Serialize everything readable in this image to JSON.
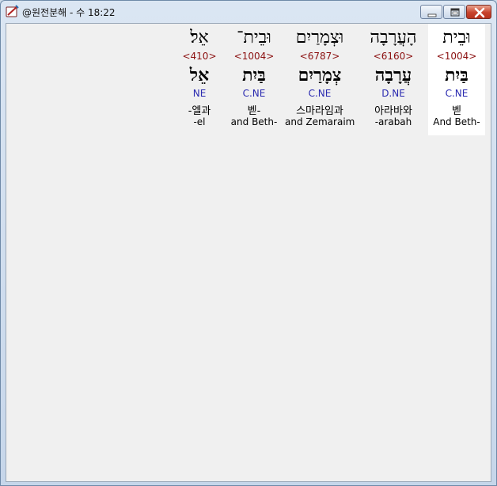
{
  "window": {
    "title": "@원전분해 - 수 18:22",
    "icon": "bible-pen-icon"
  },
  "controls": {
    "minimize": "minimize-icon",
    "maximize": "maximize-icon",
    "close": "close-icon"
  },
  "colors": {
    "strong_number": "#8b1010",
    "grammar": "#2a2ab0",
    "selected_bg": "#ffffff"
  },
  "words": [
    {
      "hebrew": "וּבֵית",
      "strong": "<1004>",
      "lemma": "בַּיִת",
      "grammar": "C.NE",
      "korean": "벧",
      "english": "And Beth-"
    },
    {
      "hebrew": "הָעֲרָבָה",
      "strong": "<6160>",
      "lemma": "עֲרָבָה",
      "grammar": "D.NE",
      "korean": "아라바와",
      "english": "-arabah"
    },
    {
      "hebrew": "וּצְמָרַיִם",
      "strong": "<6787>",
      "lemma": "צְמָרַיִם",
      "grammar": "C.NE",
      "korean": "스마라임과",
      "english": "and Zemaraim"
    },
    {
      "hebrew": "וּבֵית־",
      "strong": "<1004>",
      "lemma": "בַּיִת",
      "grammar": "C.NE",
      "korean": "벧-",
      "english": "and Beth-"
    },
    {
      "hebrew": "אֵל׃",
      "strong": "<410>",
      "lemma": "אֵל",
      "grammar": "NE",
      "korean": "-엘과",
      "english": "-el"
    }
  ]
}
